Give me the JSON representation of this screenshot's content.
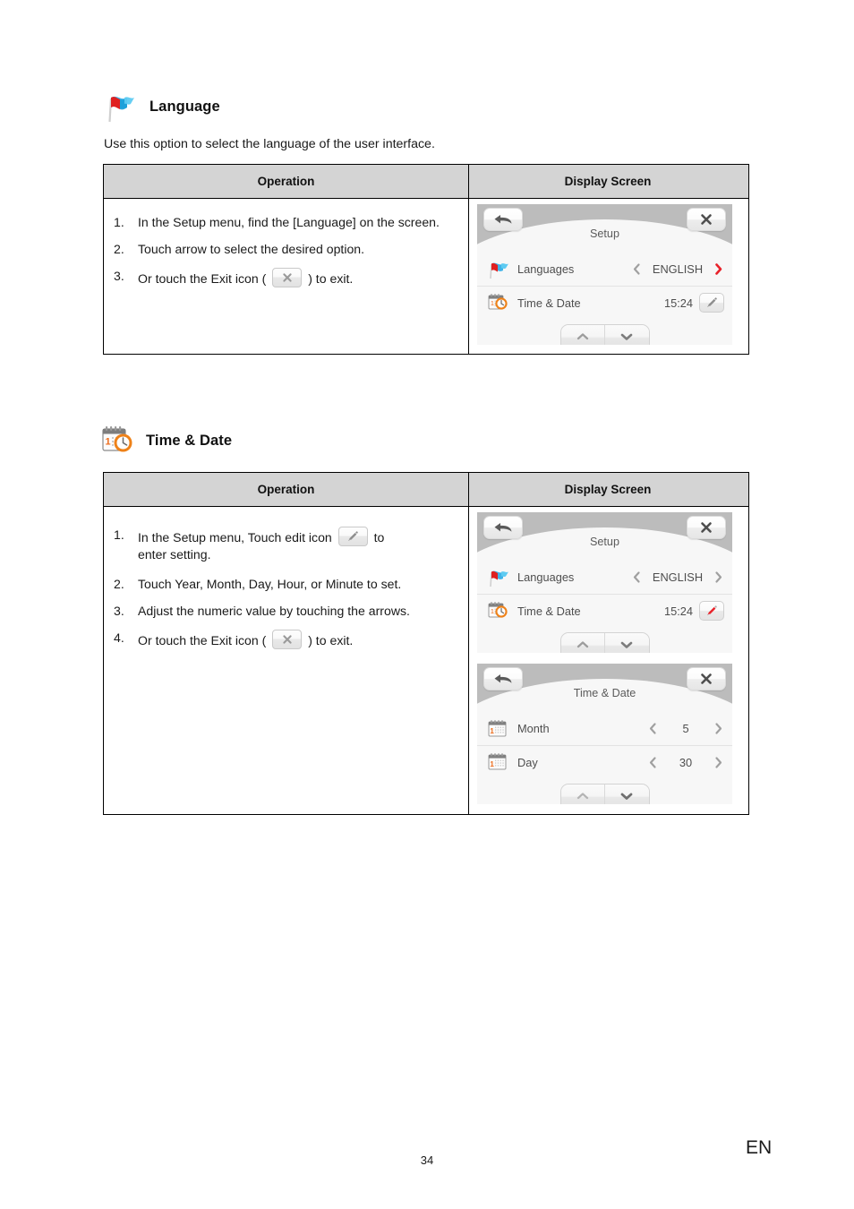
{
  "page": {
    "number": "34",
    "language_code": "EN"
  },
  "sections": [
    {
      "id": "language",
      "icon": "flag-icon",
      "title": "Language",
      "intro": "Use this option to select the language of the user interface.",
      "table": {
        "headers": {
          "operation": "Operation",
          "display": "Display Screen"
        },
        "steps": [
          {
            "num": "1.",
            "lines": [
              "In the Setup menu, find the [Language] on the screen."
            ]
          },
          {
            "num": "2.",
            "lines": [
              "Touch arrow to select the desired option."
            ]
          },
          {
            "num": "3.",
            "prefix": "Or touch the Exit icon (",
            "inline_icon": "close-icon",
            "suffix": ") to exit."
          }
        ]
      },
      "screens": [
        {
          "title": "Setup",
          "back_icon": "back-arrow-icon",
          "close_icon": "close-icon",
          "rows": [
            {
              "icon": "flag-icon",
              "label": "Languages",
              "control": "stepper",
              "value": "ENGLISH",
              "left_arrow_color": "#a0a0a0",
              "right_arrow_color": "#e8222a"
            },
            {
              "icon": "calendar-clock-icon",
              "label": "Time & Date",
              "control": "edit",
              "value": "15:24",
              "edit_icon_color": "#8e8e8e"
            }
          ],
          "pill": {
            "up": "chevron-up-icon",
            "down": "chevron-down-icon"
          }
        }
      ]
    },
    {
      "id": "time-date",
      "icon": "calendar-clock-icon",
      "title": "Time & Date",
      "intro": "",
      "table": {
        "headers": {
          "operation": "Operation",
          "display": "Display Screen"
        },
        "steps": [
          {
            "num": "1.",
            "prefix": "In the Setup menu, Touch edit icon",
            "inline_icon": "edit-pencil-icon",
            "suffix": "to",
            "lines2": "enter setting."
          },
          {
            "num": "2.",
            "lines": [
              "Touch Year, Month, Day, Hour, or Minute to set."
            ]
          },
          {
            "num": "3.",
            "lines": [
              "Adjust the numeric value by touching the arrows."
            ]
          },
          {
            "num": "4.",
            "prefix": "Or touch the Exit icon (",
            "inline_icon": "close-icon",
            "suffix": ") to exit."
          }
        ]
      },
      "screens": [
        {
          "title": "Setup",
          "back_icon": "back-arrow-icon",
          "close_icon": "close-icon",
          "rows": [
            {
              "icon": "flag-icon",
              "label": "Languages",
              "control": "stepper",
              "value": "ENGLISH",
              "left_arrow_color": "#a0a0a0",
              "right_arrow_color": "#a0a0a0"
            },
            {
              "icon": "calendar-clock-icon",
              "label": "Time & Date",
              "control": "edit",
              "value": "15:24",
              "edit_icon_color": "#e8222a"
            }
          ],
          "pill": {
            "up": "chevron-up-icon",
            "down": "chevron-down-icon"
          }
        },
        {
          "title": "Time & Date",
          "back_icon": "back-arrow-icon",
          "close_icon": "close-icon",
          "rows": [
            {
              "icon": "calendar-icon",
              "label": "Month",
              "control": "stepper",
              "value": "5",
              "left_arrow_color": "#a0a0a0",
              "right_arrow_color": "#a0a0a0"
            },
            {
              "icon": "calendar-icon",
              "label": "Day",
              "control": "stepper",
              "value": "30",
              "left_arrow_color": "#a0a0a0",
              "right_arrow_color": "#a0a0a0"
            }
          ],
          "pill": {
            "up": "chevron-up-icon",
            "down": "chevron-down-icon"
          }
        }
      ]
    }
  ],
  "colors": {
    "table_header_bg": "#d4d4d4",
    "screen_topbar": "#bcbcbc",
    "screen_bg": "#f7f7f7",
    "accent_red": "#e8222a",
    "accent_orange": "#ee8118",
    "label_gray": "#4e4e4e"
  }
}
